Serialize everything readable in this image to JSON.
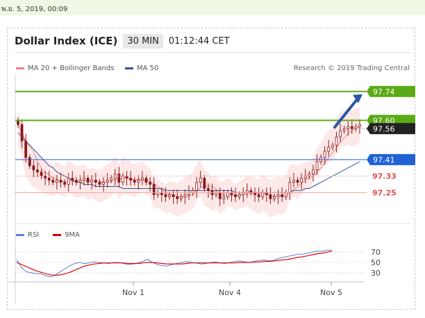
{
  "timestamp": "พ.ย. 5, 2019, 00:09",
  "header": {
    "title": "Dollar Index (ICE)",
    "interval": "30 MIN",
    "time": "01:12:44 CET"
  },
  "legend": {
    "ma20": "MA 20 + Bollinger Bands",
    "ma50": "MA 50",
    "research": "Research © 2019 Trading Central",
    "rsi": "RSI",
    "rsi_ma": "9MA"
  },
  "colors": {
    "ma20": "#f08080",
    "ma50": "#2f5597",
    "green": "#5aaa16",
    "blue": "#1f62d6",
    "red": "#e05050",
    "band_fill": "#fde4e4",
    "candle": "#8b1a1a",
    "dark_tag": "#222222"
  },
  "chart_data": [
    {
      "type": "candlestick",
      "title": "Dollar Index (ICE)",
      "interval": "30 MIN",
      "x_ticks": [
        "Nov 1",
        "Nov 4",
        "Nov 5"
      ],
      "ylim": [
        97.1,
        97.82
      ],
      "levels": [
        {
          "value": 97.74,
          "label": "97.74",
          "color": "green",
          "kind": "target"
        },
        {
          "value": 97.6,
          "label": "97.60",
          "color": "green",
          "kind": "resistance"
        },
        {
          "value": 97.56,
          "label": "97.56",
          "color": "dark",
          "kind": "last-price"
        },
        {
          "value": 97.41,
          "label": "97.41",
          "color": "blue",
          "kind": "pivot"
        },
        {
          "value": 97.33,
          "label": "97.33",
          "color": "red",
          "kind": "support"
        },
        {
          "value": 97.25,
          "label": "97.25",
          "color": "red",
          "kind": "support"
        }
      ],
      "close": [
        97.58,
        97.5,
        97.42,
        97.38,
        97.36,
        97.35,
        97.33,
        97.32,
        97.31,
        97.3,
        97.31,
        97.3,
        97.29,
        97.32,
        97.31,
        97.3,
        97.31,
        97.32,
        97.3,
        97.31,
        97.3,
        97.29,
        97.3,
        97.31,
        97.32,
        97.34,
        97.3,
        97.33,
        97.32,
        97.31,
        97.3,
        97.31,
        97.32,
        97.3,
        97.29,
        97.24,
        97.25,
        97.24,
        97.23,
        97.24,
        97.23,
        97.22,
        97.23,
        97.24,
        97.25,
        97.26,
        97.3,
        97.32,
        97.27,
        97.26,
        97.24,
        97.25,
        97.22,
        97.23,
        97.25,
        97.24,
        97.23,
        97.24,
        97.25,
        97.26,
        97.25,
        97.24,
        97.23,
        97.25,
        97.24,
        97.22,
        97.23,
        97.24,
        97.23,
        97.25,
        97.3,
        97.31,
        97.3,
        97.32,
        97.33,
        97.34,
        97.36,
        97.4,
        97.42,
        97.45,
        97.47,
        97.48,
        97.52,
        97.55,
        97.56,
        97.57,
        97.56,
        97.57,
        97.58
      ],
      "ma50": [
        97.54,
        97.52,
        97.5,
        97.48,
        97.46,
        97.44,
        97.42,
        97.4,
        97.38,
        97.37,
        97.35,
        97.34,
        97.33,
        97.32,
        97.31,
        97.3,
        97.3,
        97.29,
        97.29,
        97.29,
        97.28,
        97.28,
        97.28,
        97.28,
        97.28,
        97.28,
        97.28,
        97.27,
        97.27,
        97.27,
        97.27,
        97.27,
        97.27,
        97.27,
        97.27,
        97.27,
        97.27,
        97.27,
        97.26,
        97.26,
        97.26,
        97.26,
        97.26,
        97.26,
        97.26,
        97.26,
        97.26,
        97.26,
        97.26,
        97.26,
        97.26,
        97.26,
        97.26,
        97.26,
        97.26,
        97.26,
        97.25,
        97.25,
        97.25,
        97.25,
        97.25,
        97.25,
        97.25,
        97.25,
        97.25,
        97.25,
        97.25,
        97.25,
        97.25,
        97.25,
        97.25,
        97.26,
        97.26,
        97.26,
        97.27,
        97.27,
        97.28,
        97.29,
        97.3,
        97.31,
        97.32,
        97.33,
        97.34,
        97.35,
        97.36,
        97.37,
        97.38,
        97.39,
        97.4
      ],
      "rsi": {
        "ylim": [
          15,
          85
        ],
        "ticks": [
          "70",
          "50",
          "30"
        ],
        "values": [
          55,
          40,
          32,
          30,
          28,
          28,
          24,
          22,
          26,
          32,
          38,
          44,
          48,
          50,
          48,
          49,
          51,
          50,
          49,
          48,
          50,
          50,
          48,
          46,
          47,
          49,
          52,
          56,
          50,
          46,
          44,
          43,
          46,
          48,
          50,
          52,
          50,
          49,
          47,
          48,
          50,
          51,
          49,
          48,
          50,
          52,
          53,
          51,
          50,
          52,
          54,
          55,
          53,
          54,
          58,
          60,
          62,
          64,
          66,
          66,
          68,
          70,
          72,
          72,
          74,
          74
        ],
        "ma": [
          50,
          46,
          42,
          38,
          34,
          31,
          28,
          26,
          25,
          26,
          28,
          31,
          35,
          39,
          43,
          45,
          47,
          48,
          49,
          49,
          49,
          49,
          49,
          48,
          48,
          48,
          49,
          50,
          50,
          49,
          48,
          47,
          47,
          47,
          47,
          48,
          49,
          49,
          49,
          49,
          49,
          49,
          49,
          49,
          49,
          49,
          50,
          50,
          50,
          51,
          51,
          52,
          52,
          53,
          54,
          55,
          56,
          58,
          60,
          61,
          63,
          65,
          67,
          68,
          70,
          72
        ]
      }
    }
  ]
}
